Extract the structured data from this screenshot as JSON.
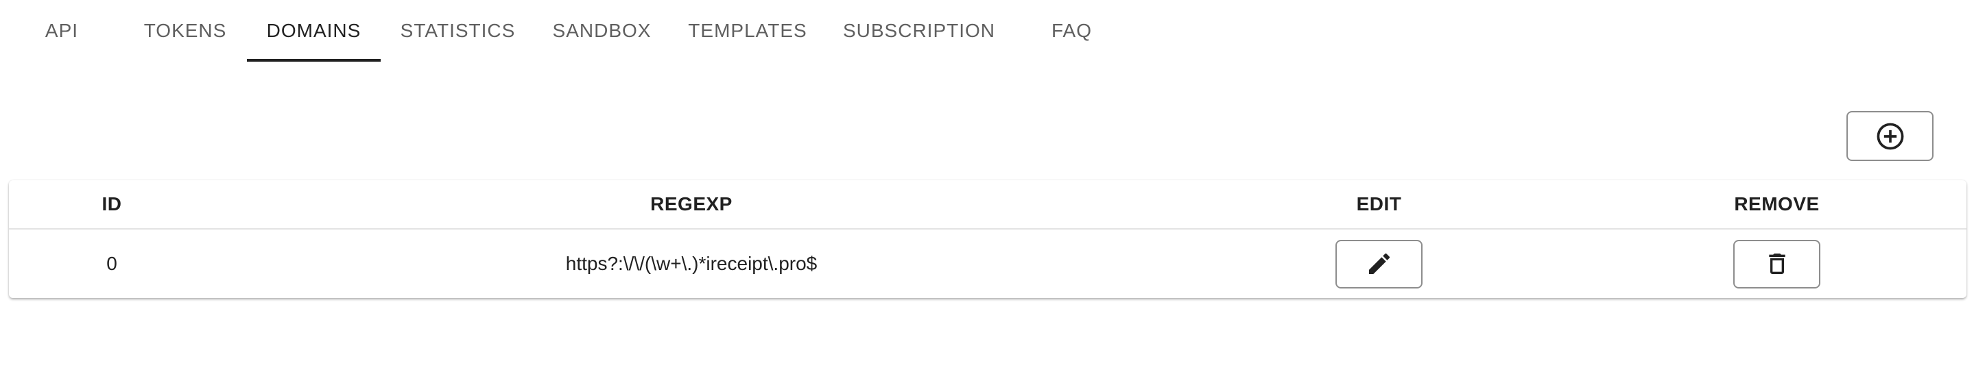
{
  "tabs": [
    {
      "label": "API",
      "active": false
    },
    {
      "label": "TOKENS",
      "active": false
    },
    {
      "label": "DOMAINS",
      "active": true
    },
    {
      "label": "STATISTICS",
      "active": false
    },
    {
      "label": "SANDBOX",
      "active": false
    },
    {
      "label": "TEMPLATES",
      "active": false
    },
    {
      "label": "SUBSCRIPTION",
      "active": false
    },
    {
      "label": "FAQ",
      "active": false
    }
  ],
  "toolbar": {
    "add_icon": "plus-circle-icon"
  },
  "table": {
    "headers": {
      "id": "ID",
      "regexp": "REGEXP",
      "edit": "EDIT",
      "remove": "REMOVE"
    },
    "rows": [
      {
        "id": "0",
        "regexp": "https?:\\/\\/(\\w+\\.)*ireceipt\\.pro$",
        "edit_icon": "pencil-icon",
        "remove_icon": "trash-icon"
      }
    ]
  },
  "colors": {
    "text": "#212121",
    "tab_inactive": "#5f5f5f",
    "border": "#8d8d8d"
  }
}
